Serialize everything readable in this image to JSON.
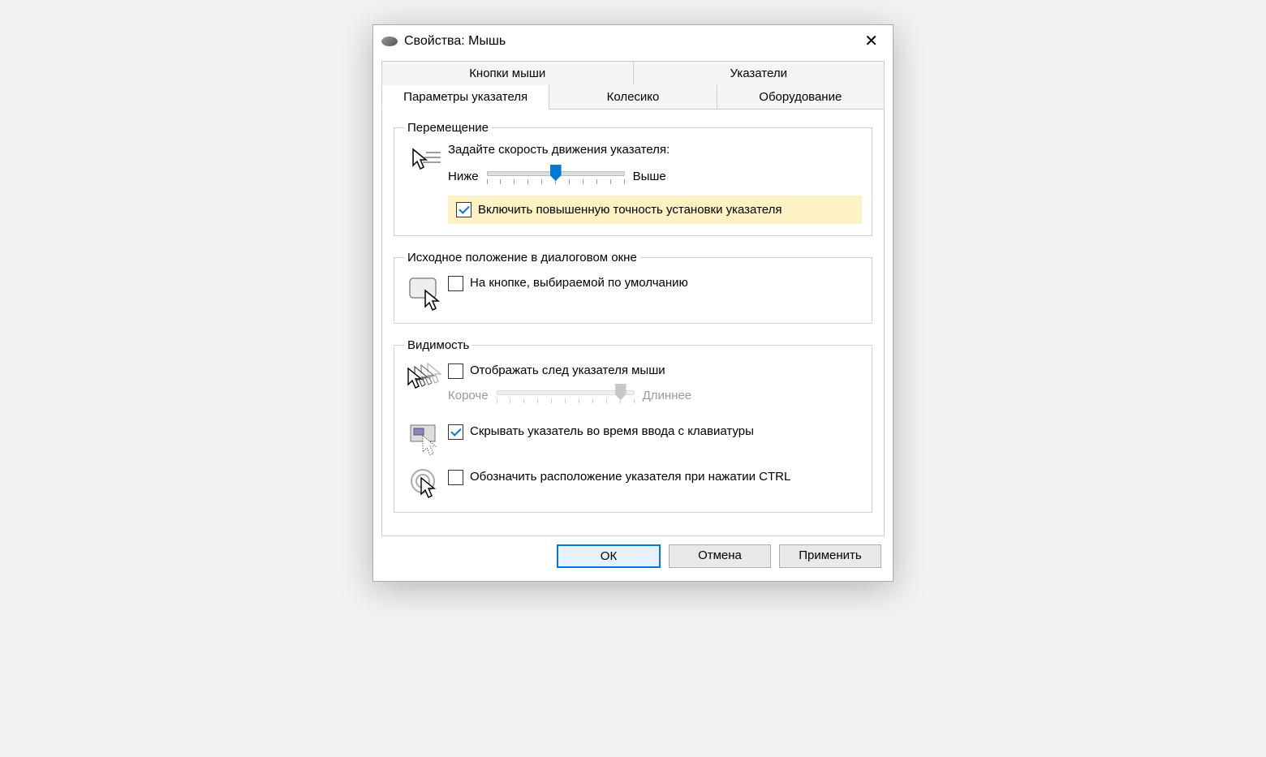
{
  "window": {
    "title": "Свойства: Мышь"
  },
  "tabs": {
    "row1": [
      "Кнопки мыши",
      "Указатели"
    ],
    "row2": [
      "Параметры указателя",
      "Колесико",
      "Оборудование"
    ],
    "active": "Параметры указателя"
  },
  "sections": {
    "motion": {
      "legend": "Перемещение",
      "prompt": "Задайте скорость движения указателя:",
      "slider": {
        "low": "Ниже",
        "high": "Выше",
        "value": 6,
        "max": 11
      },
      "enhance": {
        "checked": true,
        "label": "Включить повышенную точность установки указателя"
      }
    },
    "snapTo": {
      "legend": "Исходное положение в диалоговом окне",
      "option": {
        "checked": false,
        "label": "На кнопке, выбираемой по умолчанию"
      }
    },
    "visibility": {
      "legend": "Видимость",
      "trails": {
        "checked": false,
        "label": "Отображать след указателя мыши",
        "slider": {
          "low": "Короче",
          "high": "Длиннее",
          "value": 10,
          "max": 11
        }
      },
      "hideTyping": {
        "checked": true,
        "label": "Скрывать указатель во время ввода с клавиатуры"
      },
      "ctrlLocate": {
        "checked": false,
        "label": "Обозначить расположение указателя при нажатии CTRL"
      }
    }
  },
  "buttons": {
    "ok": "ОК",
    "cancel": "Отмена",
    "apply": "Применить"
  }
}
